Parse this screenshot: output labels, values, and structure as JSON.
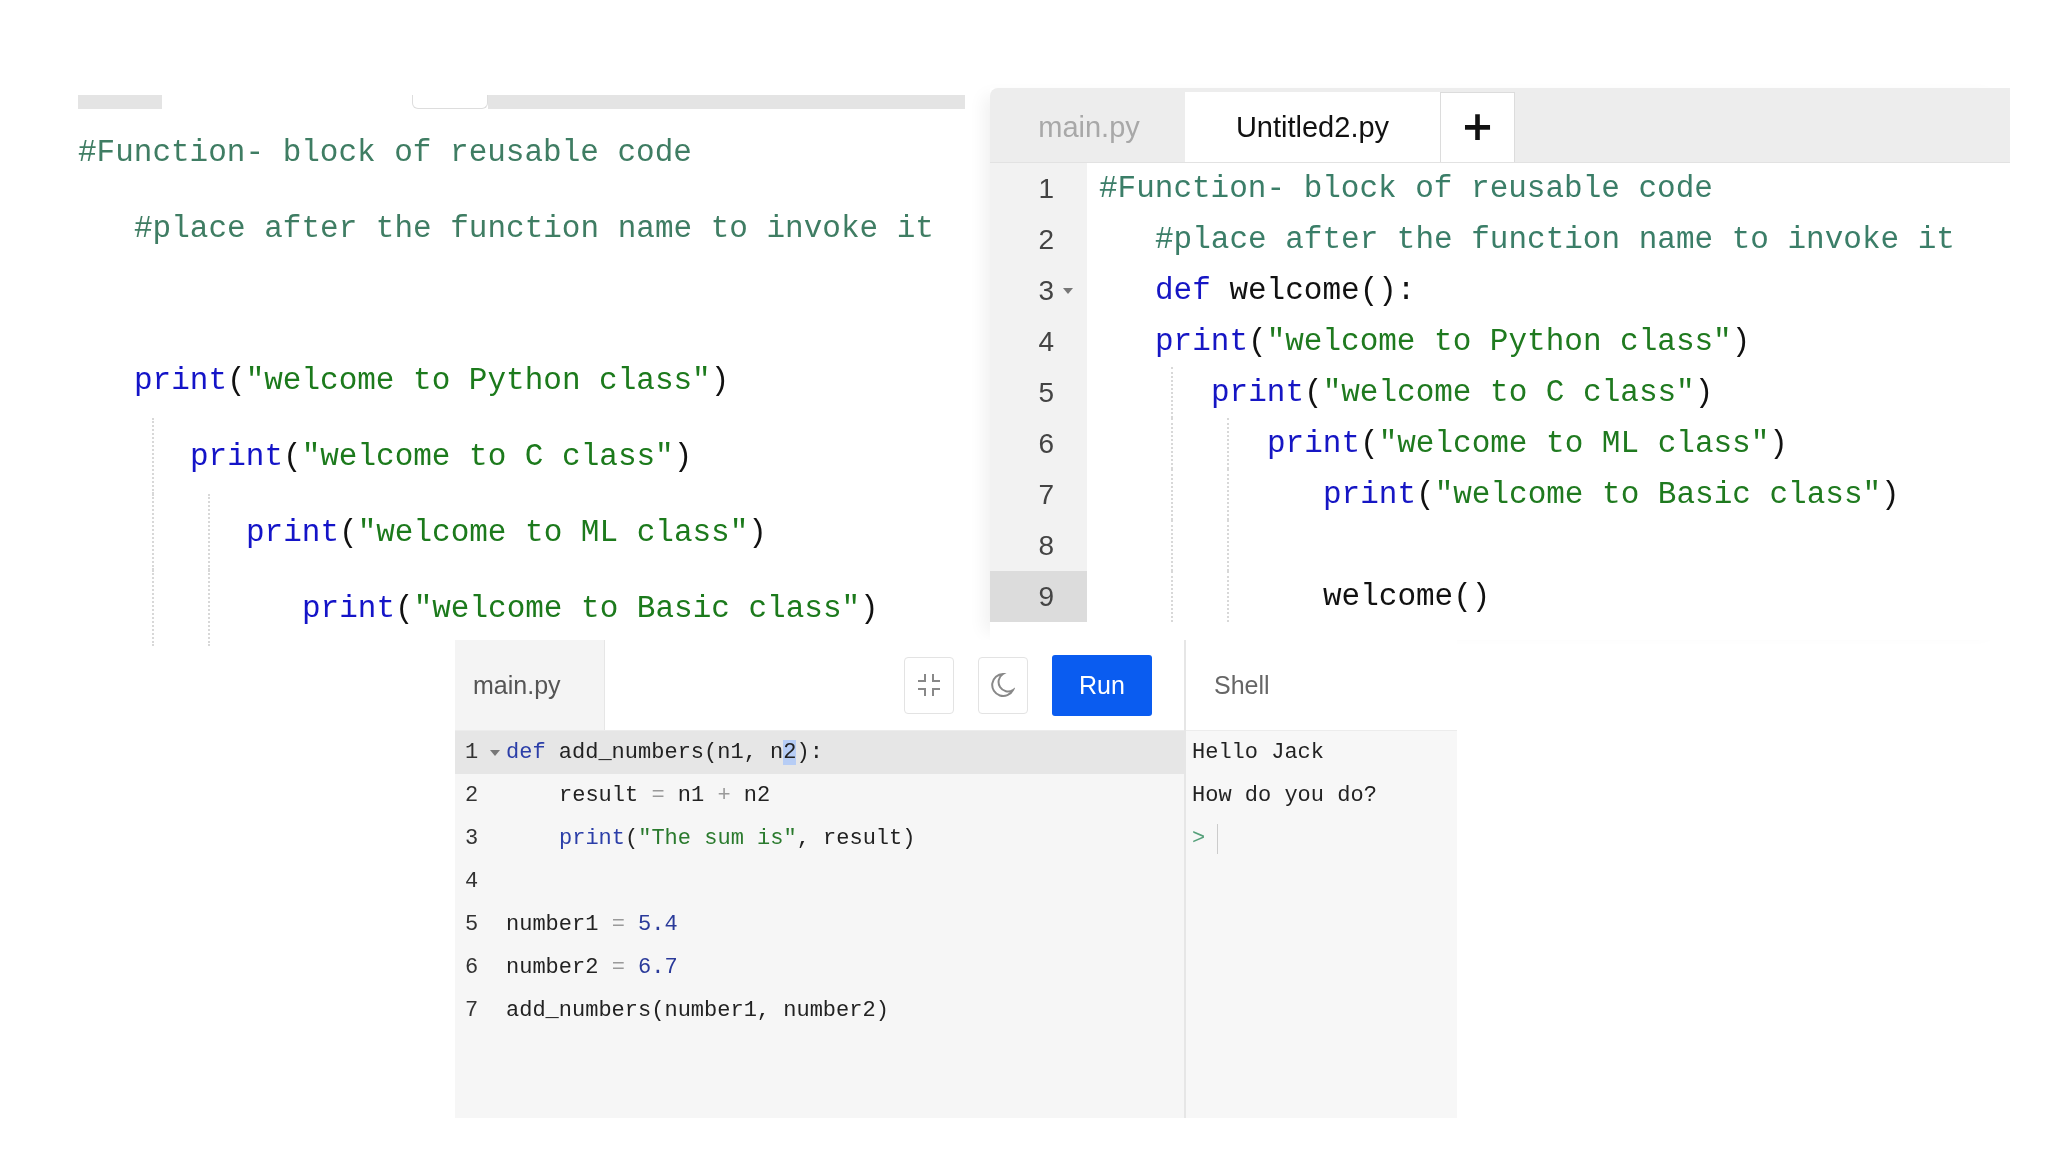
{
  "left_editor": {
    "lines": [
      {
        "blank_line_before": false,
        "tokens": [
          {
            "kind": "comment",
            "text": "#Function- block of reusable code"
          }
        ],
        "children": [
          {
            "blank_line_before": false,
            "tokens": [
              {
                "kind": "comment",
                "text": "#place after the function name to invoke it"
              }
            ]
          },
          {
            "blank_line_before": true,
            "tokens": [
              {
                "kind": "keyword",
                "text": "print"
              },
              {
                "kind": "plain",
                "text": "("
              },
              {
                "kind": "string",
                "text": "\"welcome to Python class\""
              },
              {
                "kind": "plain",
                "text": ")"
              }
            ],
            "children": [
              {
                "blank_line_before": false,
                "tokens": [
                  {
                    "kind": "keyword",
                    "text": "print"
                  },
                  {
                    "kind": "plain",
                    "text": "("
                  },
                  {
                    "kind": "string",
                    "text": "\"welcome to C class\""
                  },
                  {
                    "kind": "plain",
                    "text": ")"
                  }
                ],
                "children": [
                  {
                    "blank_line_before": false,
                    "tokens": [
                      {
                        "kind": "keyword",
                        "text": "print"
                      },
                      {
                        "kind": "plain",
                        "text": "("
                      },
                      {
                        "kind": "string",
                        "text": "\"welcome to ML class\""
                      },
                      {
                        "kind": "plain",
                        "text": ")"
                      }
                    ],
                    "children": [
                      {
                        "blank_line_before": false,
                        "tokens": [
                          {
                            "kind": "keyword",
                            "text": "print"
                          },
                          {
                            "kind": "plain",
                            "text": "("
                          },
                          {
                            "kind": "string",
                            "text": "\"welcome to Basic class\""
                          },
                          {
                            "kind": "plain",
                            "text": ")"
                          }
                        ]
                      }
                    ]
                  }
                ]
              }
            ]
          }
        ]
      }
    ]
  },
  "right_editor": {
    "tabs": [
      {
        "label": "main.py",
        "selected": false
      },
      {
        "label": "Untitled2.py",
        "selected": true
      }
    ],
    "add_tab": "+",
    "lines": [
      {
        "number": "1",
        "active": false,
        "foldable": false,
        "tokens": [
          {
            "kind": "comment",
            "text": "#Function- block of reusable code"
          }
        ],
        "children": [
          {
            "number": "2",
            "active": false,
            "foldable": false,
            "tokens": [
              {
                "kind": "comment",
                "text": "#place after the function name to invoke it"
              }
            ]
          },
          {
            "number": "3",
            "active": false,
            "foldable": true,
            "tokens": [
              {
                "kind": "keyword",
                "text": "def"
              },
              {
                "kind": "plain",
                "text": " welcome():"
              }
            ]
          },
          {
            "number": "4",
            "active": false,
            "foldable": false,
            "tokens": [
              {
                "kind": "keyword",
                "text": "print"
              },
              {
                "kind": "plain",
                "text": "("
              },
              {
                "kind": "string",
                "text": "\"welcome to Python class\""
              },
              {
                "kind": "plain",
                "text": ")"
              }
            ],
            "children": [
              {
                "number": "5",
                "active": false,
                "foldable": false,
                "tokens": [
                  {
                    "kind": "keyword",
                    "text": "print"
                  },
                  {
                    "kind": "plain",
                    "text": "("
                  },
                  {
                    "kind": "string",
                    "text": "\"welcome to C class\""
                  },
                  {
                    "kind": "plain",
                    "text": ")"
                  }
                ],
                "children": [
                  {
                    "number": "6",
                    "active": false,
                    "foldable": false,
                    "tokens": [
                      {
                        "kind": "keyword",
                        "text": "print"
                      },
                      {
                        "kind": "plain",
                        "text": "("
                      },
                      {
                        "kind": "string",
                        "text": "\"welcome to ML class\""
                      },
                      {
                        "kind": "plain",
                        "text": ")"
                      }
                    ],
                    "children": [
                      {
                        "number": "7",
                        "active": false,
                        "foldable": false,
                        "tokens": [
                          {
                            "kind": "keyword",
                            "text": "print"
                          },
                          {
                            "kind": "plain",
                            "text": "("
                          },
                          {
                            "kind": "string",
                            "text": "\"welcome to Basic class\""
                          },
                          {
                            "kind": "plain",
                            "text": ")"
                          }
                        ]
                      },
                      {
                        "number": "8",
                        "active": false,
                        "foldable": false
                      },
                      {
                        "number": "9",
                        "active": true,
                        "foldable": false,
                        "tokens": [
                          {
                            "kind": "plain",
                            "text": "welcome()"
                          }
                        ]
                      }
                    ]
                  }
                ]
              }
            ]
          }
        ]
      }
    ]
  },
  "bottom_editor": {
    "file_tab": "main.py",
    "run_button": "Run",
    "lines": [
      {
        "number": "1",
        "active": true,
        "foldable": true,
        "tokens": [
          {
            "kind": "keyword",
            "text": "def"
          },
          {
            "kind": "plain",
            "text": " add_numbers(n1, n"
          },
          {
            "kind": "selection",
            "text": "2"
          },
          {
            "kind": "plain",
            "text": "):"
          }
        ],
        "children": [
          {
            "number": "2",
            "active": false,
            "foldable": false,
            "tokens": [
              {
                "kind": "plain",
                "text": "result "
              },
              {
                "kind": "operator",
                "text": "="
              },
              {
                "kind": "plain",
                "text": " n1 "
              },
              {
                "kind": "operator",
                "text": "+"
              },
              {
                "kind": "plain",
                "text": " n2"
              }
            ]
          },
          {
            "number": "3",
            "active": false,
            "foldable": false,
            "tokens": [
              {
                "kind": "keyword",
                "text": "print"
              },
              {
                "kind": "plain",
                "text": "("
              },
              {
                "kind": "string",
                "text": "\"The sum is\""
              },
              {
                "kind": "plain",
                "text": ", result)"
              }
            ]
          }
        ]
      },
      {
        "number": "4",
        "active": false,
        "foldable": false
      },
      {
        "number": "5",
        "active": false,
        "foldable": false,
        "tokens": [
          {
            "kind": "plain",
            "text": "number1 "
          },
          {
            "kind": "operator",
            "text": "= "
          },
          {
            "kind": "number",
            "text": "5.4"
          }
        ]
      },
      {
        "number": "6",
        "active": false,
        "foldable": false,
        "tokens": [
          {
            "kind": "plain",
            "text": "number2 "
          },
          {
            "kind": "operator",
            "text": "= "
          },
          {
            "kind": "number",
            "text": "6.7"
          }
        ]
      },
      {
        "number": "7",
        "active": false,
        "foldable": false,
        "tokens": [
          {
            "kind": "plain",
            "text": "add_numbers(number1, number2)"
          }
        ]
      }
    ],
    "shell": {
      "title": "Shell",
      "lines": [
        "Hello Jack",
        "How do you do?"
      ],
      "prompt": ">"
    }
  }
}
